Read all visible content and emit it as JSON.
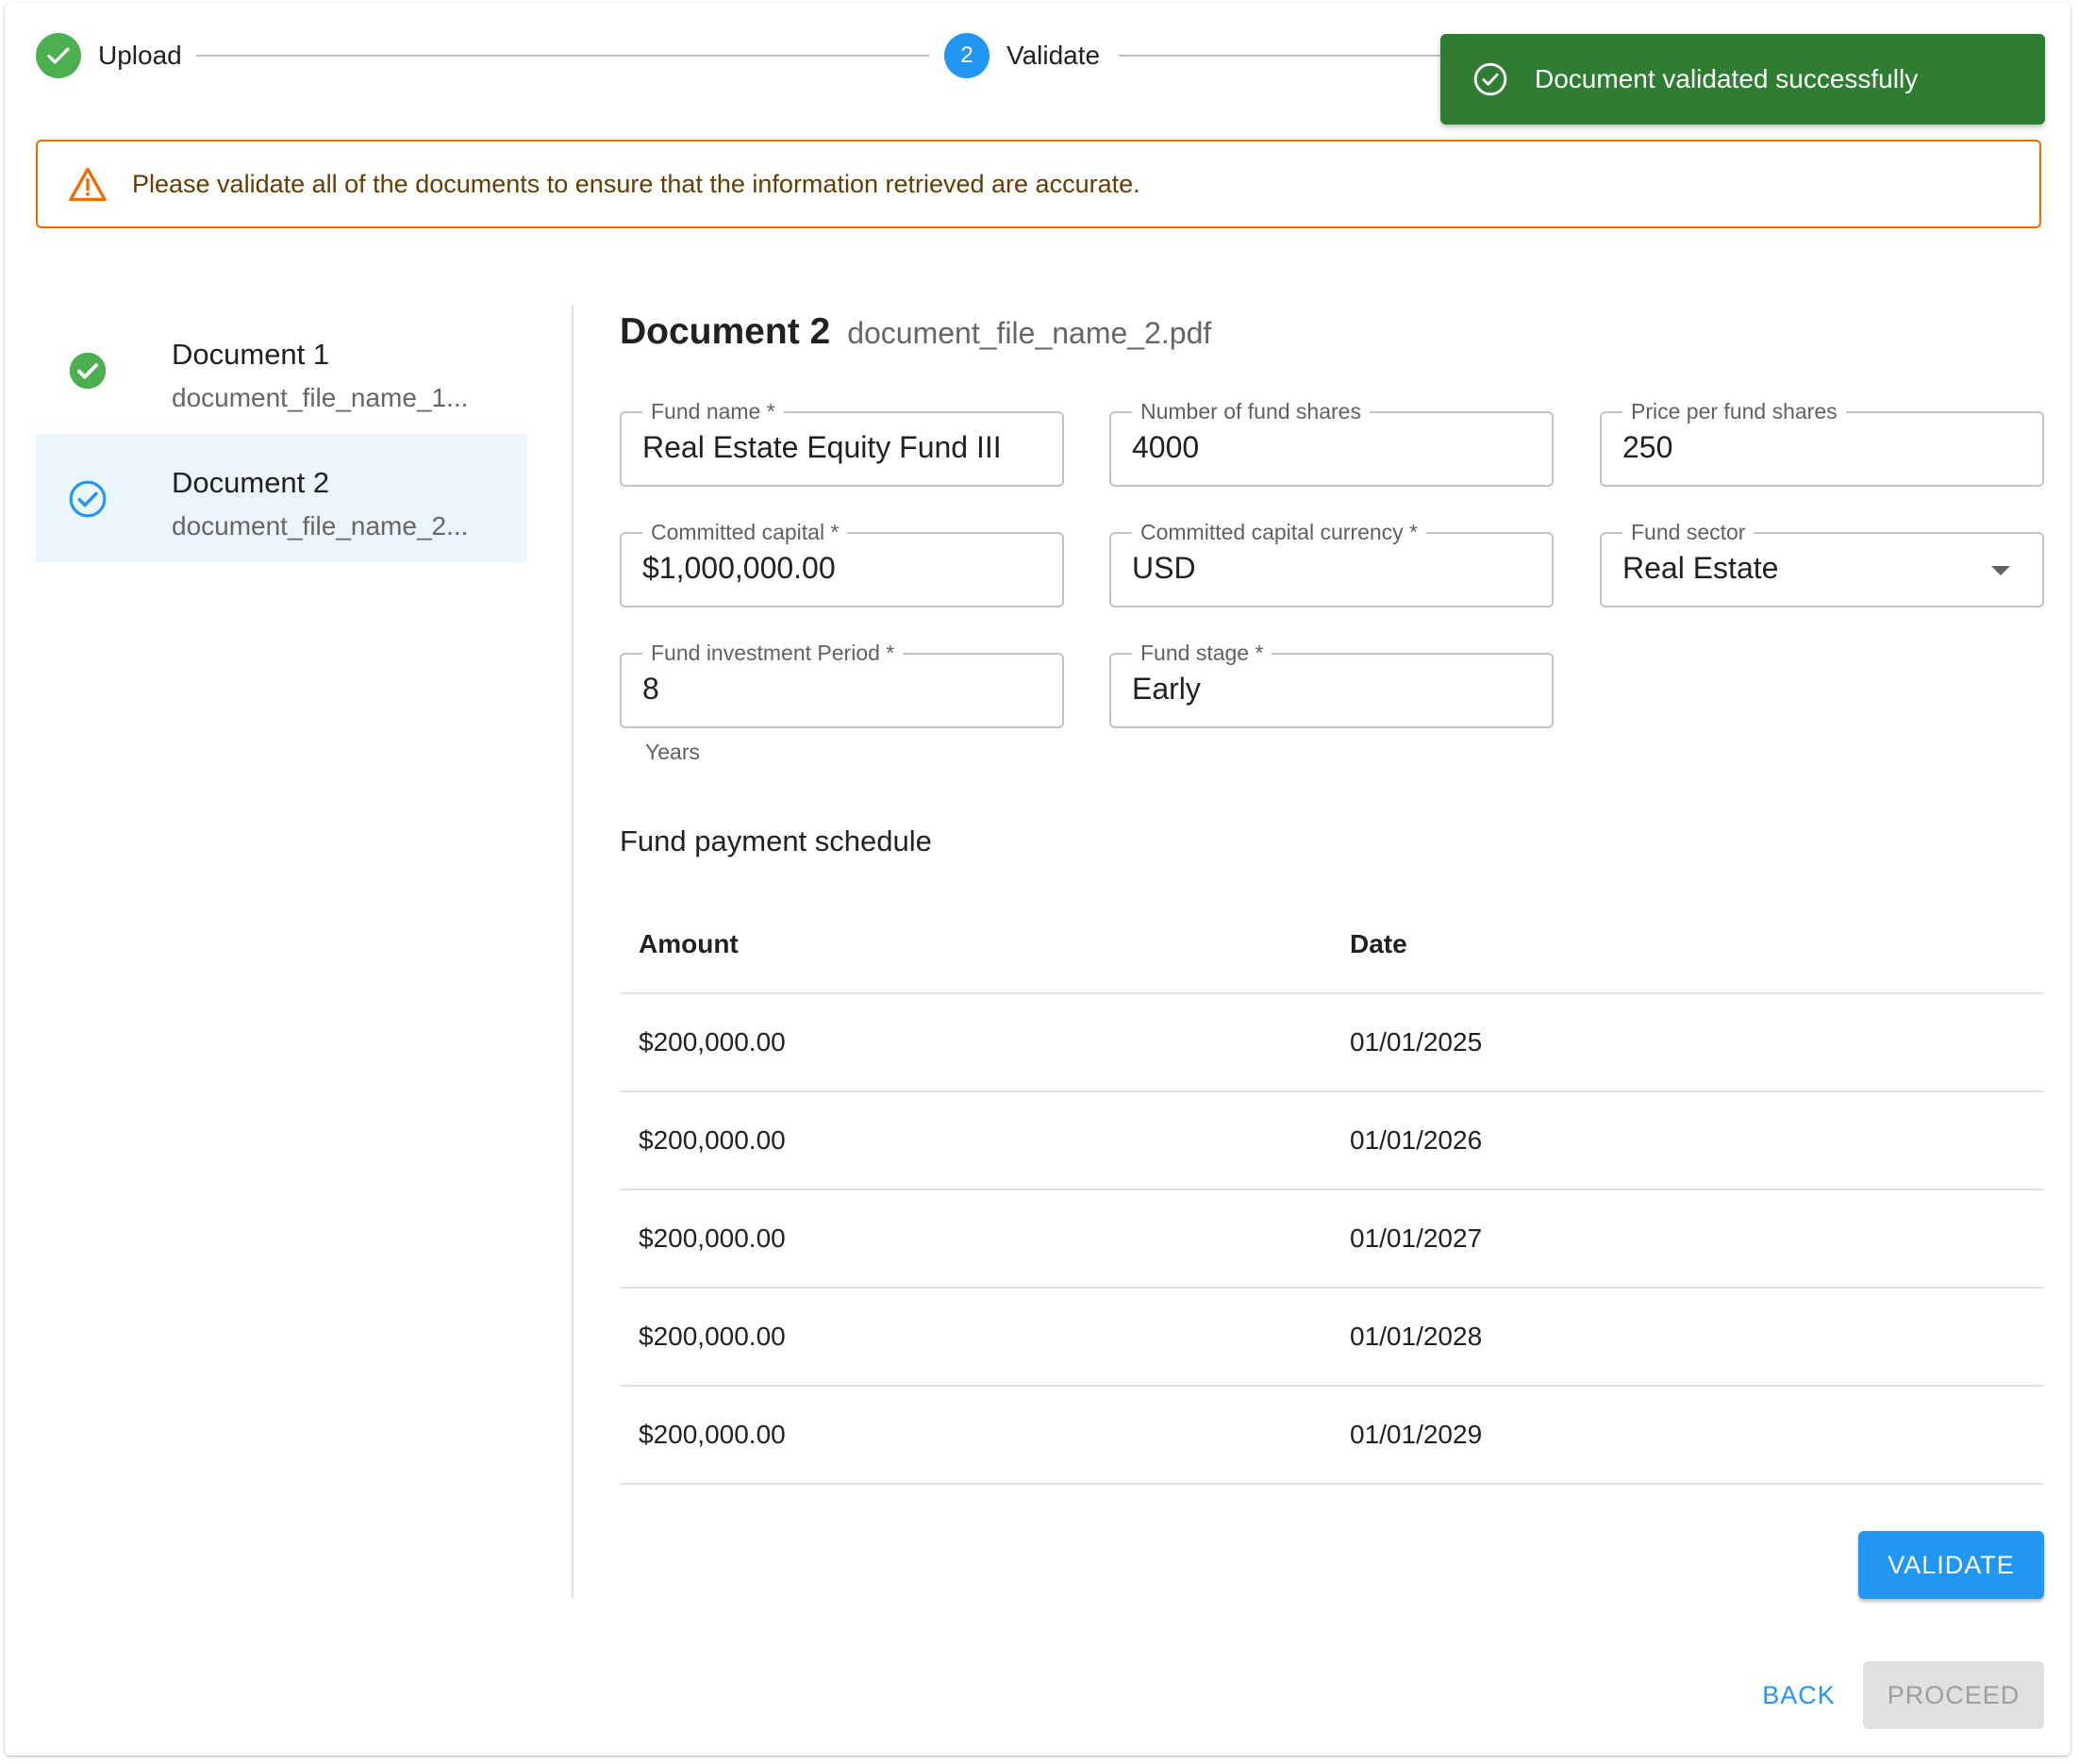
{
  "stepper": {
    "steps": [
      {
        "label": "Upload",
        "state": "completed",
        "icon": "check-icon"
      },
      {
        "label": "Validate",
        "number": "2",
        "state": "active"
      }
    ],
    "colors": {
      "completed": "#4caf50",
      "active": "#2196f3"
    }
  },
  "toast": {
    "message": "Document validated successfully",
    "icon": "check-circle-outline-icon",
    "color": "#2e7d32"
  },
  "alert": {
    "message": "Please validate all of the documents to ensure that the information retrieved are accurate.",
    "icon": "warning-icon",
    "color": "#ed6c02"
  },
  "documents": [
    {
      "title": "Document 1",
      "file": "document_file_name_1...",
      "status": "validated",
      "icon": "check-circle-icon"
    },
    {
      "title": "Document 2",
      "file": "document_file_name_2...",
      "status": "selected",
      "icon": "check-circle-outline-icon"
    }
  ],
  "detail": {
    "title": "Document 2",
    "filename": "document_file_name_2.pdf",
    "fields": {
      "fund_name": {
        "label": "Fund name *",
        "value": "Real Estate Equity Fund III"
      },
      "fund_shares": {
        "label": "Number of fund shares",
        "value": "4000"
      },
      "price_per_share": {
        "label": "Price per fund shares",
        "value": "250"
      },
      "committed_capital": {
        "label": "Committed capital *",
        "value": "$1,000,000.00"
      },
      "committed_currency": {
        "label": "Committed capital currency *",
        "value": "USD"
      },
      "fund_sector": {
        "label": "Fund sector",
        "value": "Real Estate"
      },
      "investment_period": {
        "label": "Fund investment Period *",
        "value": "8",
        "helper": "Years"
      },
      "fund_stage": {
        "label": "Fund stage *",
        "value": "Early"
      }
    },
    "schedule": {
      "title": "Fund payment schedule",
      "columns": [
        "Amount",
        "Date"
      ],
      "rows": [
        [
          "$200,000.00",
          "01/01/2025"
        ],
        [
          "$200,000.00",
          "01/01/2026"
        ],
        [
          "$200,000.00",
          "01/01/2027"
        ],
        [
          "$200,000.00",
          "01/01/2028"
        ],
        [
          "$200,000.00",
          "01/01/2029"
        ]
      ]
    },
    "validate_label": "VALIDATE"
  },
  "footer": {
    "back_label": "BACK",
    "proceed_label": "PROCEED"
  }
}
